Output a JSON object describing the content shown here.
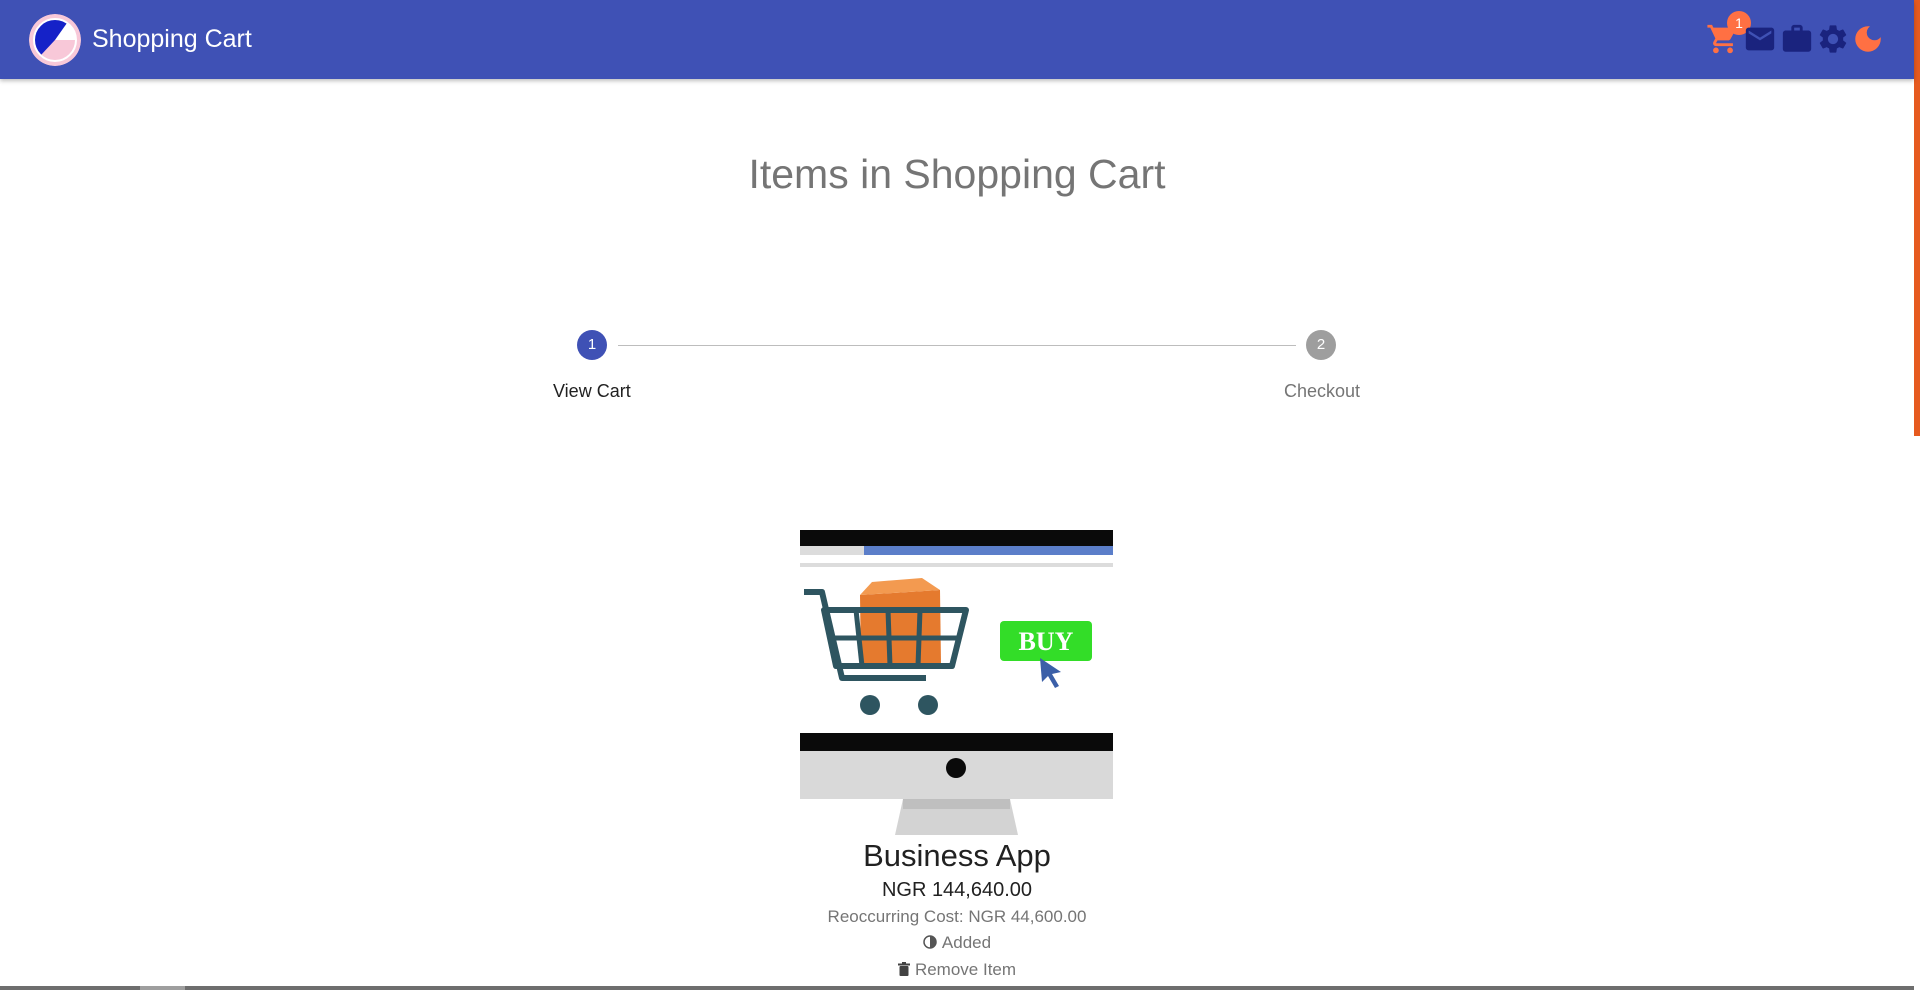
{
  "header": {
    "title": "Shopping Cart",
    "cart_badge": "1",
    "icons": [
      "cart-icon",
      "mail-icon",
      "briefcase-icon",
      "gear-icon",
      "theme-toggle-icon"
    ],
    "colors": {
      "appbar": "#3f51b5",
      "accent": "#ff7043"
    }
  },
  "page": {
    "title": "Items in Shopping Cart"
  },
  "stepper": {
    "steps": [
      {
        "number": "1",
        "label": "View Cart",
        "state": "active"
      },
      {
        "number": "2",
        "label": "Checkout",
        "state": "inactive"
      }
    ]
  },
  "product": {
    "image_text": "BUY",
    "name": "Business App",
    "price": "NGR 144,640.00",
    "recurring": "Reoccurring Cost: NGR 44,600.00",
    "status": "Added",
    "remove_label": "Remove Item"
  }
}
